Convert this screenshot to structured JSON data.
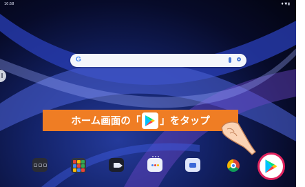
{
  "status_bar": {
    "time": "10:58",
    "icons": "♦▼▮"
  },
  "search_bar": {
    "logo": "G",
    "mic_icon": "mic-icon",
    "lens_icon": "lens-icon"
  },
  "instruction": {
    "text_before": "ホーム画面の「",
    "text_after": "」をタップ"
  },
  "dock": {
    "items": [
      "folder",
      "apps",
      "meet",
      "assistant",
      "messages",
      "chrome",
      "play-store"
    ]
  },
  "colors": {
    "banner": "#ef7d24",
    "highlight_ring": "#e0245e"
  }
}
